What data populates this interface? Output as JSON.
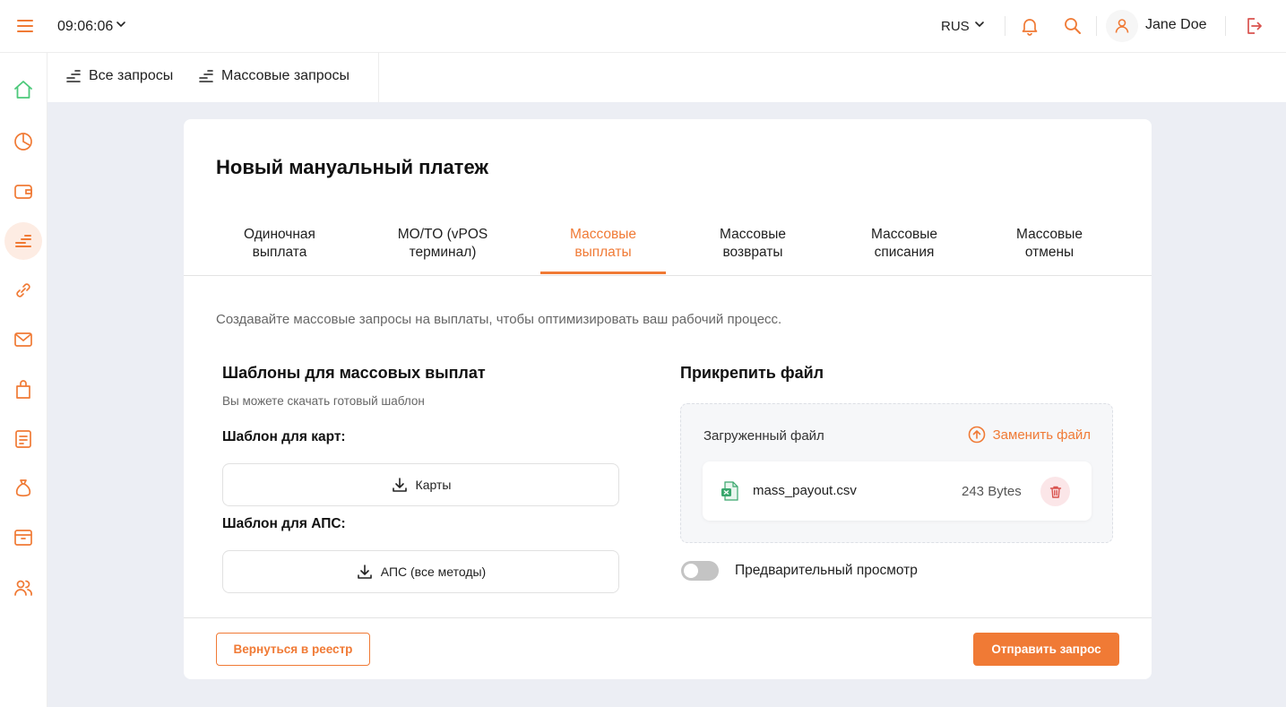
{
  "header": {
    "time": "09:06:06",
    "language": "RUS",
    "username": "Jane Doe"
  },
  "sidebar": {
    "items": [
      {
        "icon": "home-icon"
      },
      {
        "icon": "pie-chart-icon"
      },
      {
        "icon": "wallet-icon"
      },
      {
        "icon": "payouts-icon",
        "active": true
      },
      {
        "icon": "link-icon"
      },
      {
        "icon": "mail-icon"
      },
      {
        "icon": "bag-icon"
      },
      {
        "icon": "document-icon"
      },
      {
        "icon": "money-bag-icon"
      },
      {
        "icon": "archive-icon"
      },
      {
        "icon": "users-icon"
      }
    ]
  },
  "subnav": {
    "all_requests": "Все запросы",
    "mass_requests": "Массовые запросы"
  },
  "card": {
    "title": "Новый мануальный платеж",
    "tabs": [
      {
        "line1": "Одиночная",
        "line2": "выплата"
      },
      {
        "line1": "MO/TO (vPOS",
        "line2": "терминал)"
      },
      {
        "line1": "Массовые",
        "line2": "выплаты",
        "active": true
      },
      {
        "line1": "Массовые",
        "line2": "возвраты"
      },
      {
        "line1": "Массовые",
        "line2": "списания"
      },
      {
        "line1": "Массовые",
        "line2": "отмены"
      }
    ],
    "description": "Создавайте массовые запросы на выплаты, чтобы оптимизировать ваш рабочий процесс.",
    "templates": {
      "title": "Шаблоны для массовых выплат",
      "subtitle": "Вы можете скачать готовый шаблон",
      "cards_label": "Шаблон для карт:",
      "cards_button": "Карты",
      "aps_label": "Шаблон для АПС:",
      "aps_button": "АПС (все методы)"
    },
    "attach": {
      "title": "Прикрепить файл",
      "uploaded_label": "Загруженный файл",
      "replace_label": "Заменить файл",
      "file_name": "mass_payout.csv",
      "file_size": "243 Bytes",
      "preview_label": "Предварительный просмотр",
      "preview_enabled": false
    },
    "back_button": "Вернуться в реестр",
    "submit_button": "Отправить запрос"
  },
  "colors": {
    "accent": "#f07a35",
    "background": "#eceef4",
    "active_tab": "#f07a35",
    "home_icon": "#4cc97a",
    "logout_icon": "#d9534f"
  }
}
